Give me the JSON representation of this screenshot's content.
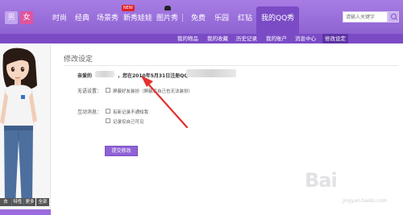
{
  "topnav": {
    "gender_male": "男",
    "gender_female": "女",
    "items": [
      "时尚",
      "经典",
      "场景秀",
      "新秀娃娃",
      "图片秀",
      "免费",
      "乐园",
      "红钻",
      "我的QQ秀"
    ],
    "new_badge": "NEW",
    "search_placeholder": "请输入关键字"
  },
  "subnav": {
    "items": [
      "我的物品",
      "我的收藏",
      "历史记录",
      "我的账户",
      "消息中心",
      "修改设定"
    ],
    "active_index": 5
  },
  "avatar_panel": {
    "tabs": [
      "衣",
      "特性",
      "更多",
      "全部"
    ]
  },
  "content": {
    "title": "修改设定",
    "dear_label": "亲爱的",
    "registration_text": "，您在2010年5月31日注册QQ",
    "visibility_label": "无语设置：",
    "visibility_option": "屏蔽好友装扮（屏蔽后自己也无法装扮）",
    "interaction_label": "互动消息：",
    "option_no_notify": "有新记录不通知我",
    "option_self_only": "记录仅自己可见",
    "submit": "提交修改"
  },
  "watermark": {
    "text": "Bai",
    "sub": "jingyan.baidu.com"
  },
  "colors": {
    "nav": "#8e63d2",
    "subnav": "#7b4bc6",
    "accent_button": "#8f62d6",
    "arrow": "#e5302f"
  }
}
